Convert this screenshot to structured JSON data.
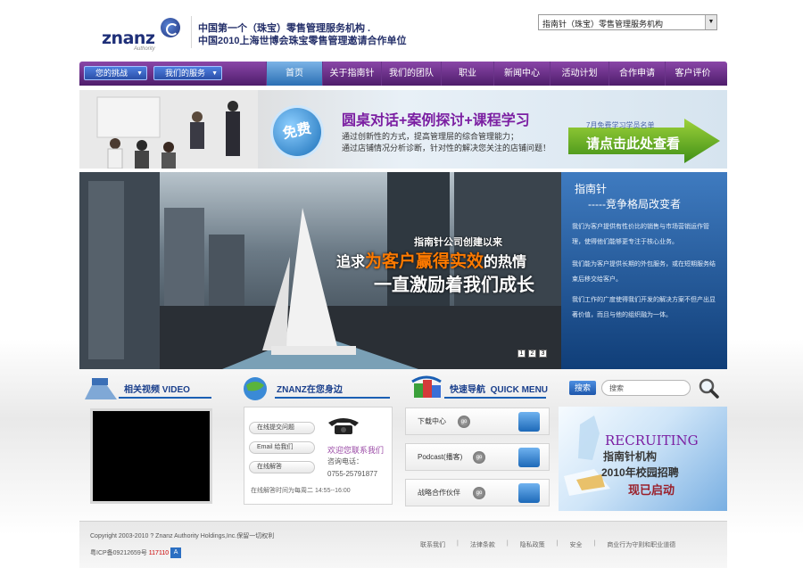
{
  "header": {
    "logo_text": "znanz",
    "logo_sub": "Authority",
    "tagline1": "中国第一个（珠宝）零售管理服务机构 .",
    "tagline2": "中国2010上海世博会珠宝零售管理邀请合作单位",
    "site_select_value": "指南针（珠宝）零售管理服务机构"
  },
  "nav": {
    "btn_challenge": "您的挑战",
    "btn_services": "我们的服务",
    "items": [
      "首页",
      "关于指南针",
      "我们的团队",
      "职业",
      "新闻中心",
      "活动计划",
      "合作申请",
      "客户评价"
    ],
    "active_index": 0
  },
  "banner": {
    "badge": "免费",
    "headline": "圆桌对话+案例探讨+课程学习",
    "line1": "通过创新性的方式，提高管理层的综合管理能力；",
    "line2": "通过店铺情况分析诊断，针对性的解决您关注的店铺问题！",
    "small": "7月免费学习学员名单",
    "cta": "请点击此处查看"
  },
  "hero": {
    "line1": "指南针公司创建以来",
    "line2_pre": "追求",
    "line2_hl": "为客户赢得实效",
    "line2_post": "的热情",
    "line3": "一直激励着我们成长",
    "dots": [
      "1",
      "2",
      "3"
    ]
  },
  "side": {
    "title1": "指南针",
    "title2": "-----竞争格局改变者",
    "p1": "我们为客户提供有性价比的销售与市场营销运作管理，使得他们能够更专注于核心业务。",
    "p2": "我们能为客户提供长期的外包服务，或在短期服务结束后移交给客户。",
    "p3": "我们工作的广度使得我们开发的解决方案不但产出显著价值，而且与他的组织融为一体。"
  },
  "sections": {
    "video": {
      "cn": "相关视频",
      "en": "VIDEO"
    },
    "near": {
      "cn": "ZNANZ在您身边"
    },
    "quick": {
      "cn": "快速导航",
      "en": "QUICK MENU"
    }
  },
  "contact": {
    "pills": [
      "在线提交问题",
      "Email 给我们",
      "在线解答"
    ],
    "welcome": "欢迎您联系我们",
    "tel_label": "咨询电话：",
    "tel_number": "0755-25791877",
    "online": "在线解答时间为每周二  14:55--16:00"
  },
  "quick": {
    "items": [
      "下载中心",
      "Podcast(播客)",
      "战略合作伙伴"
    ],
    "go": "go"
  },
  "search": {
    "button": "搜索",
    "placeholder": "搜索"
  },
  "recruit": {
    "en": "RECRUITING",
    "org": "指南针机构",
    "campus": "2010年校园招聘",
    "launch": "现已启动"
  },
  "footer": {
    "copyright": "Copyright 2003-2010 ? Znanz Authority Holdings,Inc.保留一切权利",
    "icp": "粤ICP备09212659号",
    "icp_num": "117110",
    "links": [
      "联系我们",
      "法律条款",
      "隐私政策",
      "安全",
      "商业行为守则和职业道德"
    ]
  },
  "colors": {
    "nav_purple": "#5b2478",
    "nav_active": "#3a7fc4",
    "side_blue": "#1f5da3",
    "accent_orange": "#ff7a00",
    "headline_purple": "#7b1fa2"
  }
}
